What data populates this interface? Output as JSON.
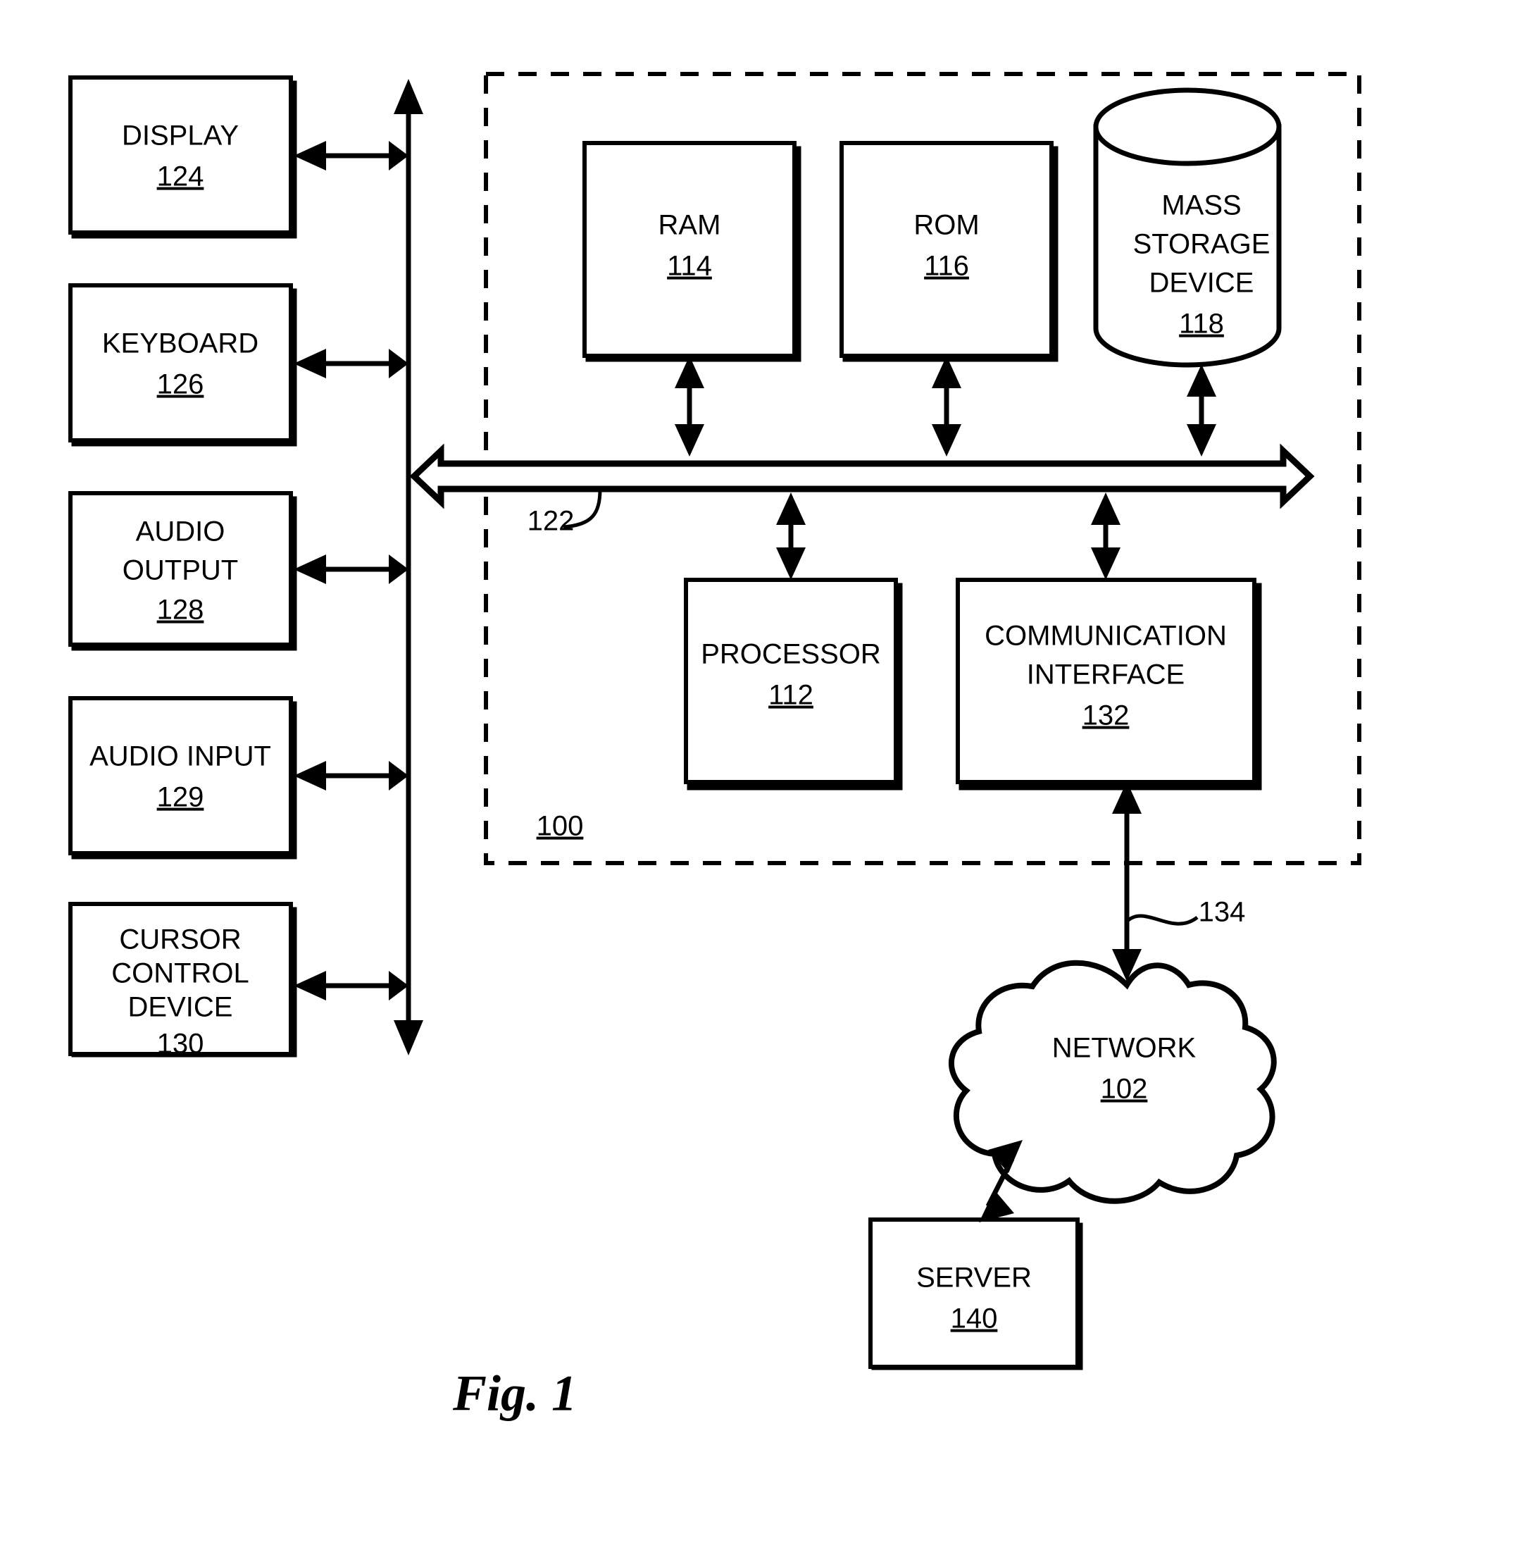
{
  "figure": {
    "caption": "Fig. 1",
    "system_ref": "100"
  },
  "peripherals": [
    {
      "name": "display",
      "label": "DISPLAY",
      "ref": "124"
    },
    {
      "name": "keyboard",
      "label": "KEYBOARD",
      "ref": "126"
    },
    {
      "name": "audio-output",
      "label_line1": "AUDIO",
      "label_line2": "OUTPUT",
      "ref": "128"
    },
    {
      "name": "audio-input",
      "label": "AUDIO INPUT",
      "ref": "129"
    },
    {
      "name": "cursor-control-device",
      "label_line1": "CURSOR",
      "label_line2": "CONTROL",
      "label_line3": "DEVICE",
      "ref": "130"
    }
  ],
  "components": {
    "ram": {
      "label": "RAM",
      "ref": "114"
    },
    "rom": {
      "label": "ROM",
      "ref": "116"
    },
    "mass_storage": {
      "label_line1": "MASS",
      "label_line2": "STORAGE",
      "label_line3": "DEVICE",
      "ref": "118"
    },
    "processor": {
      "label": "PROCESSOR",
      "ref": "112"
    },
    "communication_interface": {
      "label_line1": "COMMUNICATION",
      "label_line2": "INTERFACE",
      "ref": "132"
    }
  },
  "bus": {
    "ref": "122"
  },
  "network_link": {
    "ref": "134"
  },
  "network": {
    "label": "NETWORK",
    "ref": "102"
  },
  "server": {
    "label": "SERVER",
    "ref": "140"
  },
  "colors": {
    "stroke": "#000000",
    "background": "#ffffff"
  }
}
